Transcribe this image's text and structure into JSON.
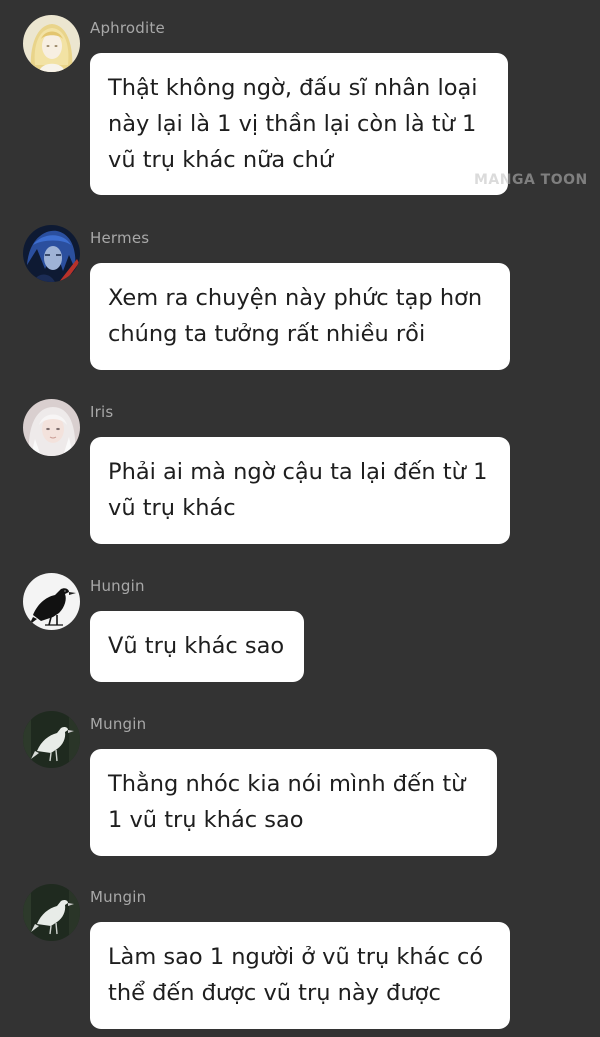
{
  "messages": [
    {
      "sender": "Aphrodite",
      "avatar_icon": "aphrodite-avatar-icon",
      "text": "Thật không ngờ, đấu sĩ nhân loại này lại là 1 vị thần lại còn là từ 1 vũ trụ khác nữa chứ"
    },
    {
      "sender": "Hermes",
      "avatar_icon": "hermes-avatar-icon",
      "text": "Xem ra chuyện này phức tạp hơn chúng ta tưởng rất nhiều rồi"
    },
    {
      "sender": "Iris",
      "avatar_icon": "iris-avatar-icon",
      "text": "Phải ai mà ngờ cậu ta lại đến từ 1 vũ trụ khác"
    },
    {
      "sender": "Hungin",
      "avatar_icon": "raven-avatar-icon",
      "text": "Vũ trụ khác sao"
    },
    {
      "sender": "Mungin",
      "avatar_icon": "white-raven-avatar-icon",
      "text": "Thằng nhóc kia nói mình đến từ 1 vũ trụ khác sao"
    },
    {
      "sender": "Mungin",
      "avatar_icon": "white-raven-avatar-icon",
      "text": "Làm sao 1 người ở vũ trụ khác có thể đến được vũ trụ này được"
    }
  ],
  "watermark": "MANGA TOON",
  "colors": {
    "background": "#333333",
    "bubble": "#ffffff",
    "sender_text": "#a8a8a8",
    "message_text": "#1e1e1e"
  }
}
